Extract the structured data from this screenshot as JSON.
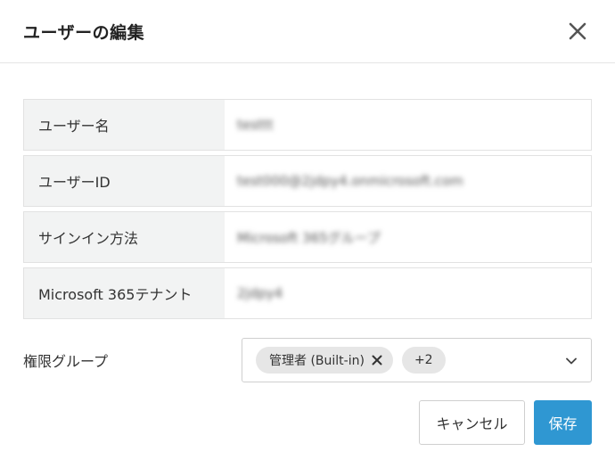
{
  "dialog": {
    "title": "ユーザーの編集"
  },
  "icons": {
    "close": "close-icon",
    "chip_remove": "close-icon",
    "dropdown": "chevron-down-icon"
  },
  "info": {
    "username_label": "ユーザー名",
    "username_value": "testtt",
    "userid_label": "ユーザーID",
    "userid_value": "test000@2jdpy4.onmicrosoft.com",
    "signin_label": "サインイン方法",
    "signin_value": "Microsoft 365グループ",
    "tenant_label": "Microsoft 365テナント",
    "tenant_value": "2jdpy4"
  },
  "groups": {
    "label": "権限グループ",
    "chip_label": "管理者 (Built-in)",
    "more_label": "+2"
  },
  "footer": {
    "cancel_label": "キャンセル",
    "save_label": "保存"
  },
  "colors": {
    "primary": "#2f97d2",
    "label_bg": "#f2f3f3",
    "chip_bg": "#e6e6e6"
  }
}
